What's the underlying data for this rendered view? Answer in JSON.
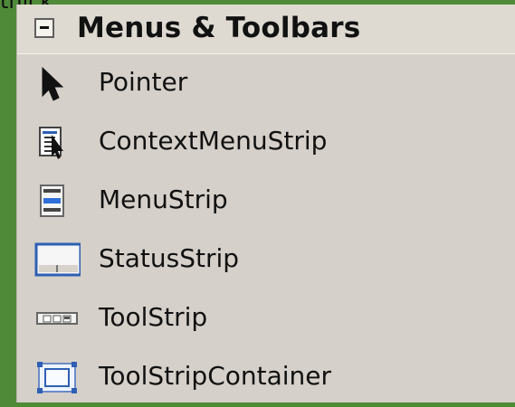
{
  "background_fragment": "tnick",
  "group": {
    "title": "Menus & Toolbars"
  },
  "items": [
    {
      "label": "Pointer",
      "icon": "pointer-icon"
    },
    {
      "label": "ContextMenuStrip",
      "icon": "context-menu-strip-icon"
    },
    {
      "label": "MenuStrip",
      "icon": "menu-strip-icon"
    },
    {
      "label": "StatusStrip",
      "icon": "status-strip-icon"
    },
    {
      "label": "ToolStrip",
      "icon": "tool-strip-icon"
    },
    {
      "label": "ToolStripContainer",
      "icon": "tool-strip-container-icon"
    }
  ],
  "colors": {
    "window_background": "#4f8a39",
    "panel_background": "#d5d0c9",
    "accent_blue": "#2f5fb4"
  }
}
